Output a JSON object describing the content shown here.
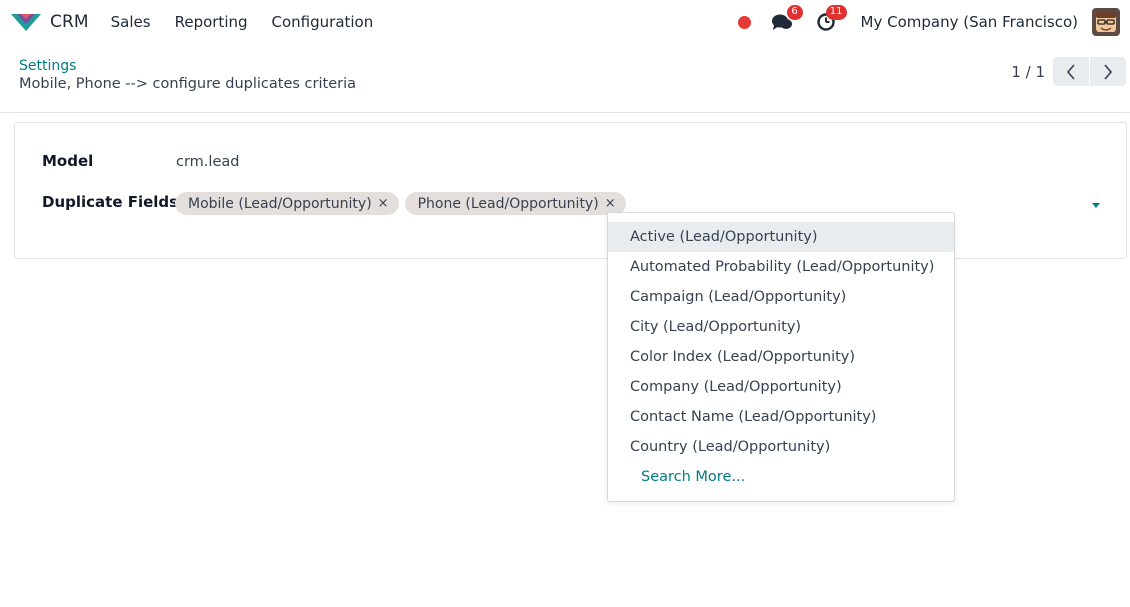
{
  "navbar": {
    "app_name": "CRM",
    "menu": [
      "Sales",
      "Reporting",
      "Configuration"
    ],
    "messages_count": "6",
    "activities_count": "11",
    "company": "My Company (San Francisco)",
    "icons": {
      "brand": "crm-logo-icon",
      "messages": "chat-bubbles-icon",
      "activities": "clock-icon",
      "status": "status-dot"
    }
  },
  "control_panel": {
    "breadcrumb_parent": "Settings",
    "breadcrumb_current": "Mobile, Phone --> configure duplicates criteria",
    "pager": "1 / 1"
  },
  "form": {
    "model_label": "Model",
    "model_value": "crm.lead",
    "duplicate_fields_label": "Duplicate Fields",
    "tags": [
      {
        "label": "Mobile (Lead/Opportunity)",
        "remove": "×"
      },
      {
        "label": "Phone (Lead/Opportunity)",
        "remove": "×"
      }
    ]
  },
  "autocomplete": {
    "options": [
      "Active (Lead/Opportunity)",
      "Automated Probability (Lead/Opportunity)",
      "Campaign (Lead/Opportunity)",
      "City (Lead/Opportunity)",
      "Color Index (Lead/Opportunity)",
      "Company (Lead/Opportunity)",
      "Contact Name (Lead/Opportunity)",
      "Country (Lead/Opportunity)"
    ],
    "search_more": "Search More..."
  },
  "colors": {
    "accent": "#017e84",
    "badge": "#e03131",
    "status_dot": "#e53935",
    "tag_bg": "#e4dfdc",
    "active_option_bg": "#e9ecef"
  }
}
